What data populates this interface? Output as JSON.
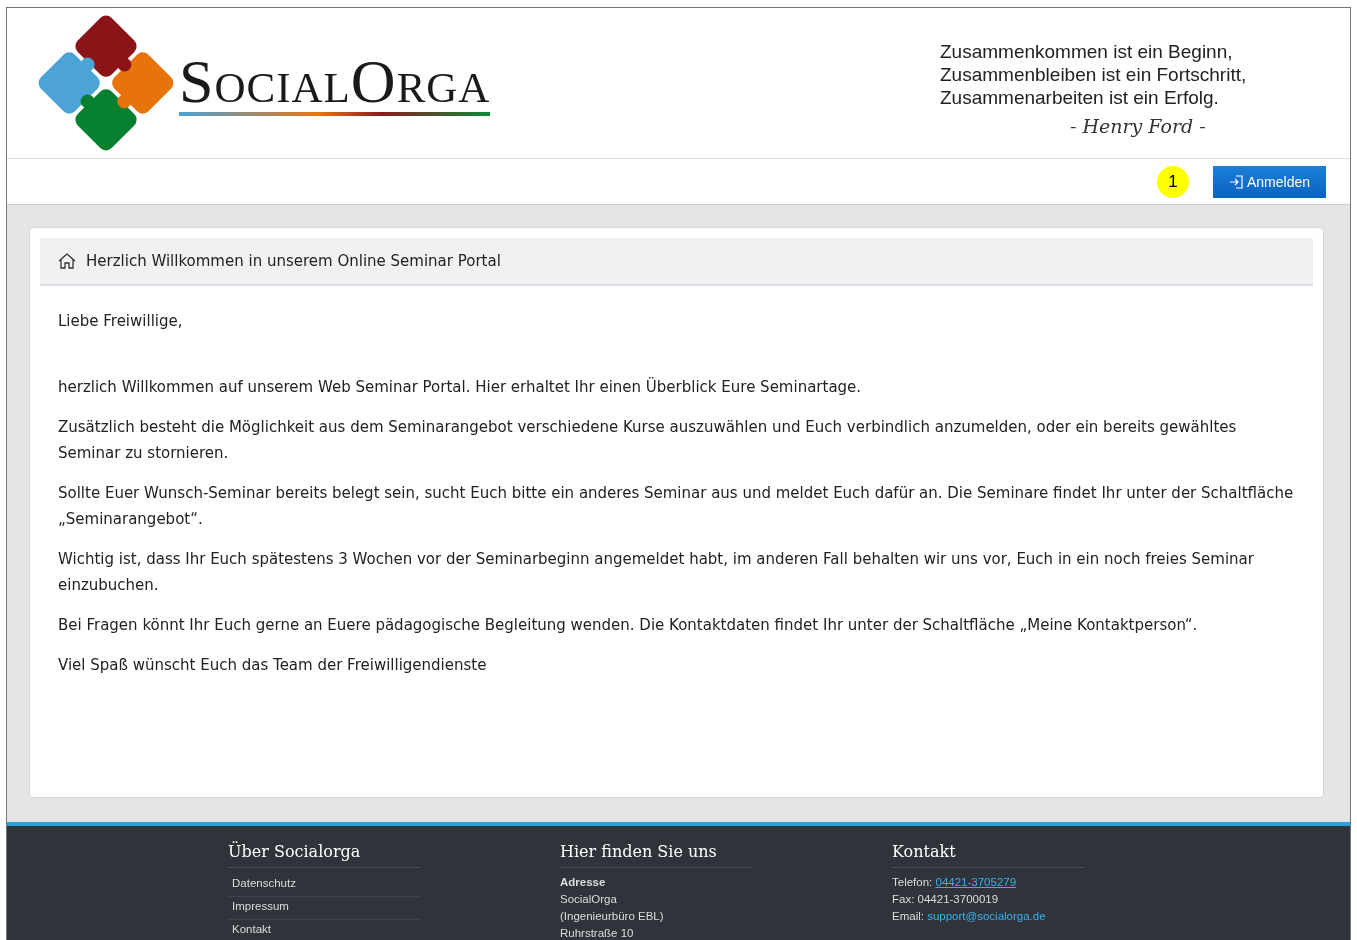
{
  "header": {
    "logo_text": "SocialOrga",
    "quote_lines": [
      "Zusammenkommen ist ein Beginn,",
      "Zusammenbleiben ist ein Fortschritt,",
      "Zusammenarbeiten ist ein Erfolg."
    ],
    "signature": "- Henry Ford -"
  },
  "navbar": {
    "marker": "1",
    "login_button": "Anmelden"
  },
  "card": {
    "title": "Herzlich Willkommen in unserem Online Seminar Portal",
    "greeting": "Liebe Freiwillige,",
    "paragraphs": [
      "herzlich Willkommen auf unserem Web Seminar Portal. Hier erhaltet Ihr einen Überblick Eure Seminartage.",
      "Zusätzlich besteht die Möglichkeit aus dem Seminarangebot verschiedene Kurse auszuwählen und Euch verbindlich anzumelden, oder ein bereits gewähltes Seminar zu stornieren.",
      "Sollte Euer Wunsch-Seminar bereits belegt sein, sucht Euch bitte ein anderes Seminar aus und meldet Euch dafür an. Die Seminare findet Ihr unter der Schaltfläche „Seminarangebot“.",
      "Wichtig ist, dass Ihr Euch spätestens 3 Wochen vor der Seminarbeginn angemeldet habt, im anderen Fall behalten wir uns vor, Euch in ein noch freies Seminar einzubuchen.",
      "Bei Fragen könnt Ihr Euch gerne an Euere pädagogische Begleitung wenden. Die Kontaktdaten findet Ihr unter der Schaltfläche „Meine Kontaktperson“.",
      "Viel Spaß wünscht Euch das Team der Freiwilligendienste"
    ]
  },
  "footer": {
    "about": {
      "title": "Über Socialorga",
      "links": [
        "Datenschutz",
        "Impressum",
        "Kontakt"
      ]
    },
    "address": {
      "title": "Hier finden Sie uns",
      "label": "Adresse",
      "lines": [
        "SocialOrga",
        "(Ingenieurbüro EBL)",
        "Ruhrstraße 10"
      ]
    },
    "contact": {
      "title": "Kontakt",
      "phone_label": "Telefon:",
      "phone": "04421-3705279",
      "fax": "Fax: 04421-3700019",
      "email_label": "Email:",
      "email": "support@socialorga.de"
    }
  }
}
